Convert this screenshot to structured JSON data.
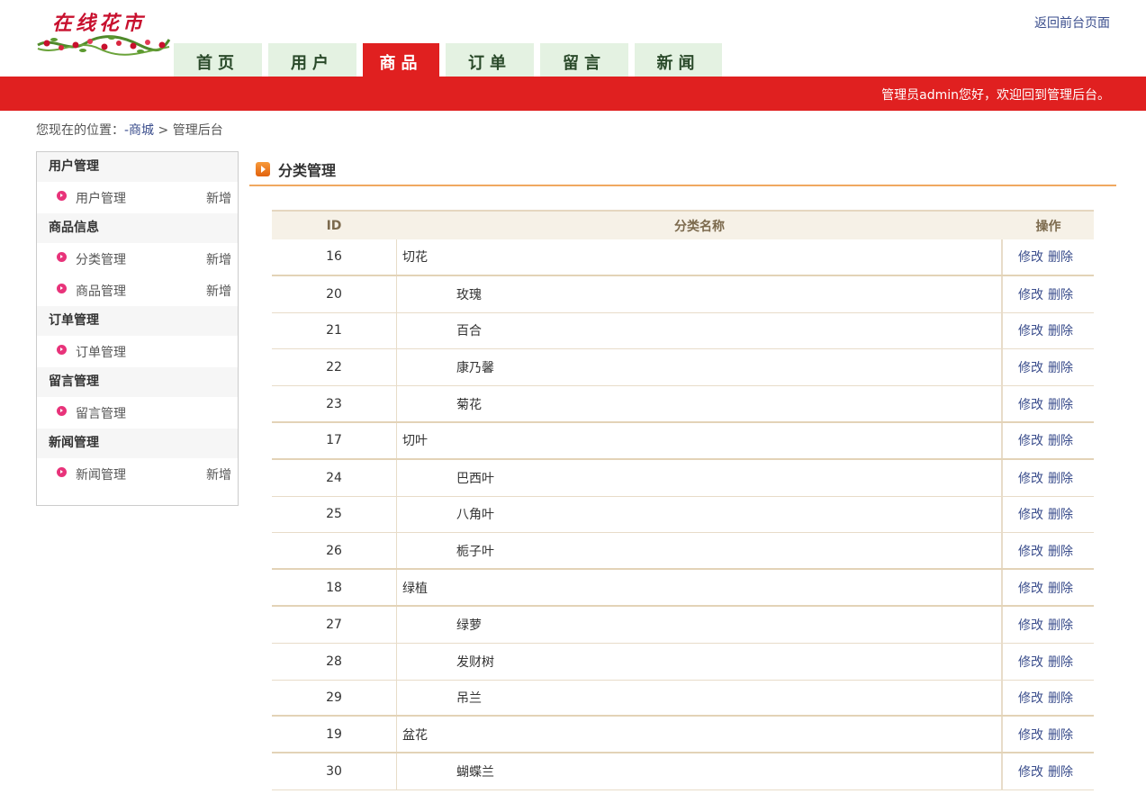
{
  "header": {
    "logo_text": "在线花市",
    "back_link": "返回前台页面",
    "welcome": "管理员admin您好，欢迎回到管理后台。"
  },
  "nav": {
    "tabs": [
      {
        "label": "首页"
      },
      {
        "label": "用户"
      },
      {
        "label": "商品"
      },
      {
        "label": "订单"
      },
      {
        "label": "留言"
      },
      {
        "label": "新闻"
      }
    ],
    "active_index": 2
  },
  "breadcrumb": {
    "prefix": "您现在的位置：",
    "link": "-商城",
    "separator": ">",
    "current": "管理后台"
  },
  "sidebar": {
    "groups": [
      {
        "title": "用户管理",
        "items": [
          {
            "label": "用户管理",
            "add": "新增"
          }
        ]
      },
      {
        "title": "商品信息",
        "items": [
          {
            "label": "分类管理",
            "add": "新增"
          },
          {
            "label": "商品管理",
            "add": "新增"
          }
        ]
      },
      {
        "title": "订单管理",
        "items": [
          {
            "label": "订单管理",
            "add": ""
          }
        ]
      },
      {
        "title": "留言管理",
        "items": [
          {
            "label": "留言管理",
            "add": ""
          }
        ]
      },
      {
        "title": "新闻管理",
        "items": [
          {
            "label": "新闻管理",
            "add": "新增"
          }
        ]
      }
    ]
  },
  "main": {
    "title": "分类管理",
    "table": {
      "headers": {
        "id": "ID",
        "name": "分类名称",
        "ops": "操作"
      },
      "edit_label": "修改",
      "delete_label": "删除",
      "rows": [
        {
          "id": "16",
          "name": "切花",
          "child": false
        },
        {
          "id": "20",
          "name": "玫瑰",
          "child": true
        },
        {
          "id": "21",
          "name": "百合",
          "child": true
        },
        {
          "id": "22",
          "name": "康乃馨",
          "child": true
        },
        {
          "id": "23",
          "name": "菊花",
          "child": true
        },
        {
          "id": "17",
          "name": "切叶",
          "child": false
        },
        {
          "id": "24",
          "name": "巴西叶",
          "child": true
        },
        {
          "id": "25",
          "name": "八角叶",
          "child": true
        },
        {
          "id": "26",
          "name": "栀子叶",
          "child": true
        },
        {
          "id": "18",
          "name": "绿植",
          "child": false
        },
        {
          "id": "27",
          "name": "绿萝",
          "child": true
        },
        {
          "id": "28",
          "name": "发财树",
          "child": true
        },
        {
          "id": "29",
          "name": "吊兰",
          "child": true
        },
        {
          "id": "19",
          "name": "盆花",
          "child": false
        },
        {
          "id": "30",
          "name": "蝴蝶兰",
          "child": true
        }
      ]
    }
  },
  "colors": {
    "brand_red": "#e02020",
    "tab_green": "#e4f2e2",
    "link_blue": "#3a4d8c",
    "accent_orange": "#f0a860",
    "bullet_pink": "#e8337a"
  }
}
